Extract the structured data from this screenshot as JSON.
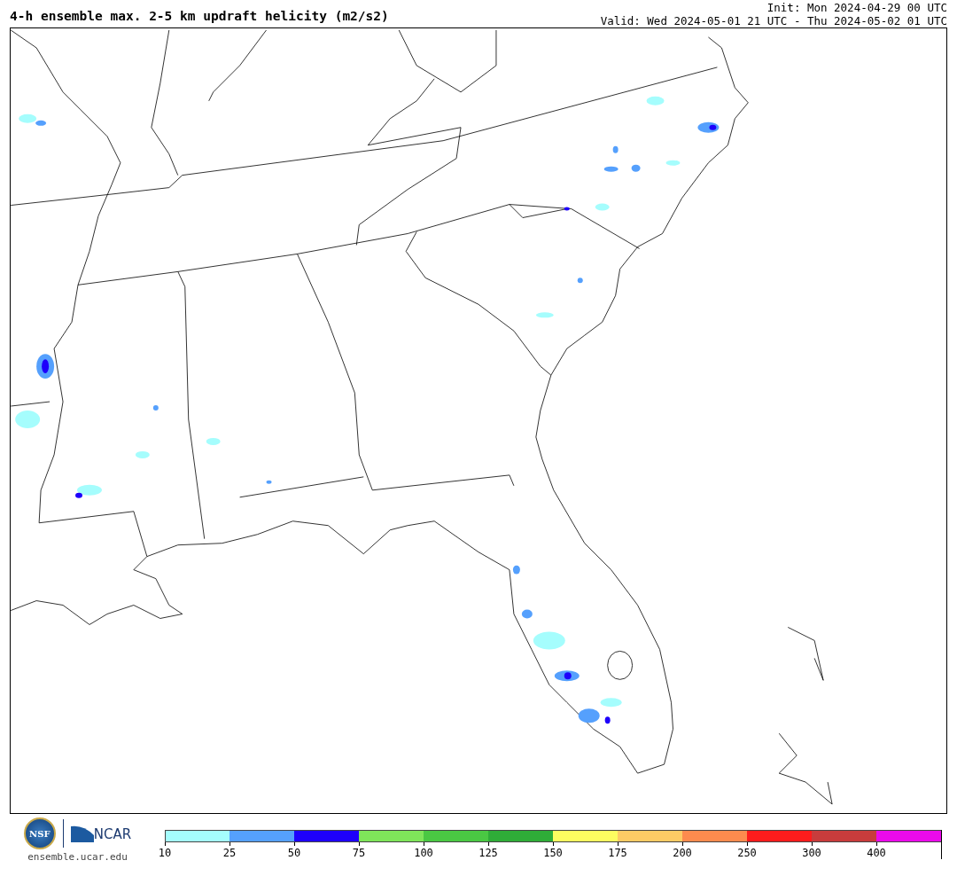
{
  "title": "4-h ensemble max. 2-5 km updraft helicity (m2/s2)",
  "init": "Init: Mon 2024-04-29 00 UTC",
  "valid": "Valid: Wed 2024-05-01 21 UTC - Thu 2024-05-02 01 UTC",
  "logos": {
    "nsf": "NSF",
    "ncar": "NCAR"
  },
  "site": "ensemble.ucar.edu",
  "colorbar": [
    {
      "color": "#a5fdfd",
      "label": "10"
    },
    {
      "color": "#55a0fd",
      "label": "25"
    },
    {
      "color": "#1e00fb",
      "label": "50"
    },
    {
      "color": "#7fe55a",
      "label": "75"
    },
    {
      "color": "#4ac843",
      "label": "100"
    },
    {
      "color": "#2fad38",
      "label": "125"
    },
    {
      "color": "#fdfd60",
      "label": "150"
    },
    {
      "color": "#fdcb65",
      "label": "175"
    },
    {
      "color": "#fd8b4e",
      "label": "200"
    },
    {
      "color": "#fd1c1c",
      "label": "250"
    },
    {
      "color": "#c83c3c",
      "label": "300"
    },
    {
      "color": "#eb0aeb",
      "label": "400"
    }
  ]
}
